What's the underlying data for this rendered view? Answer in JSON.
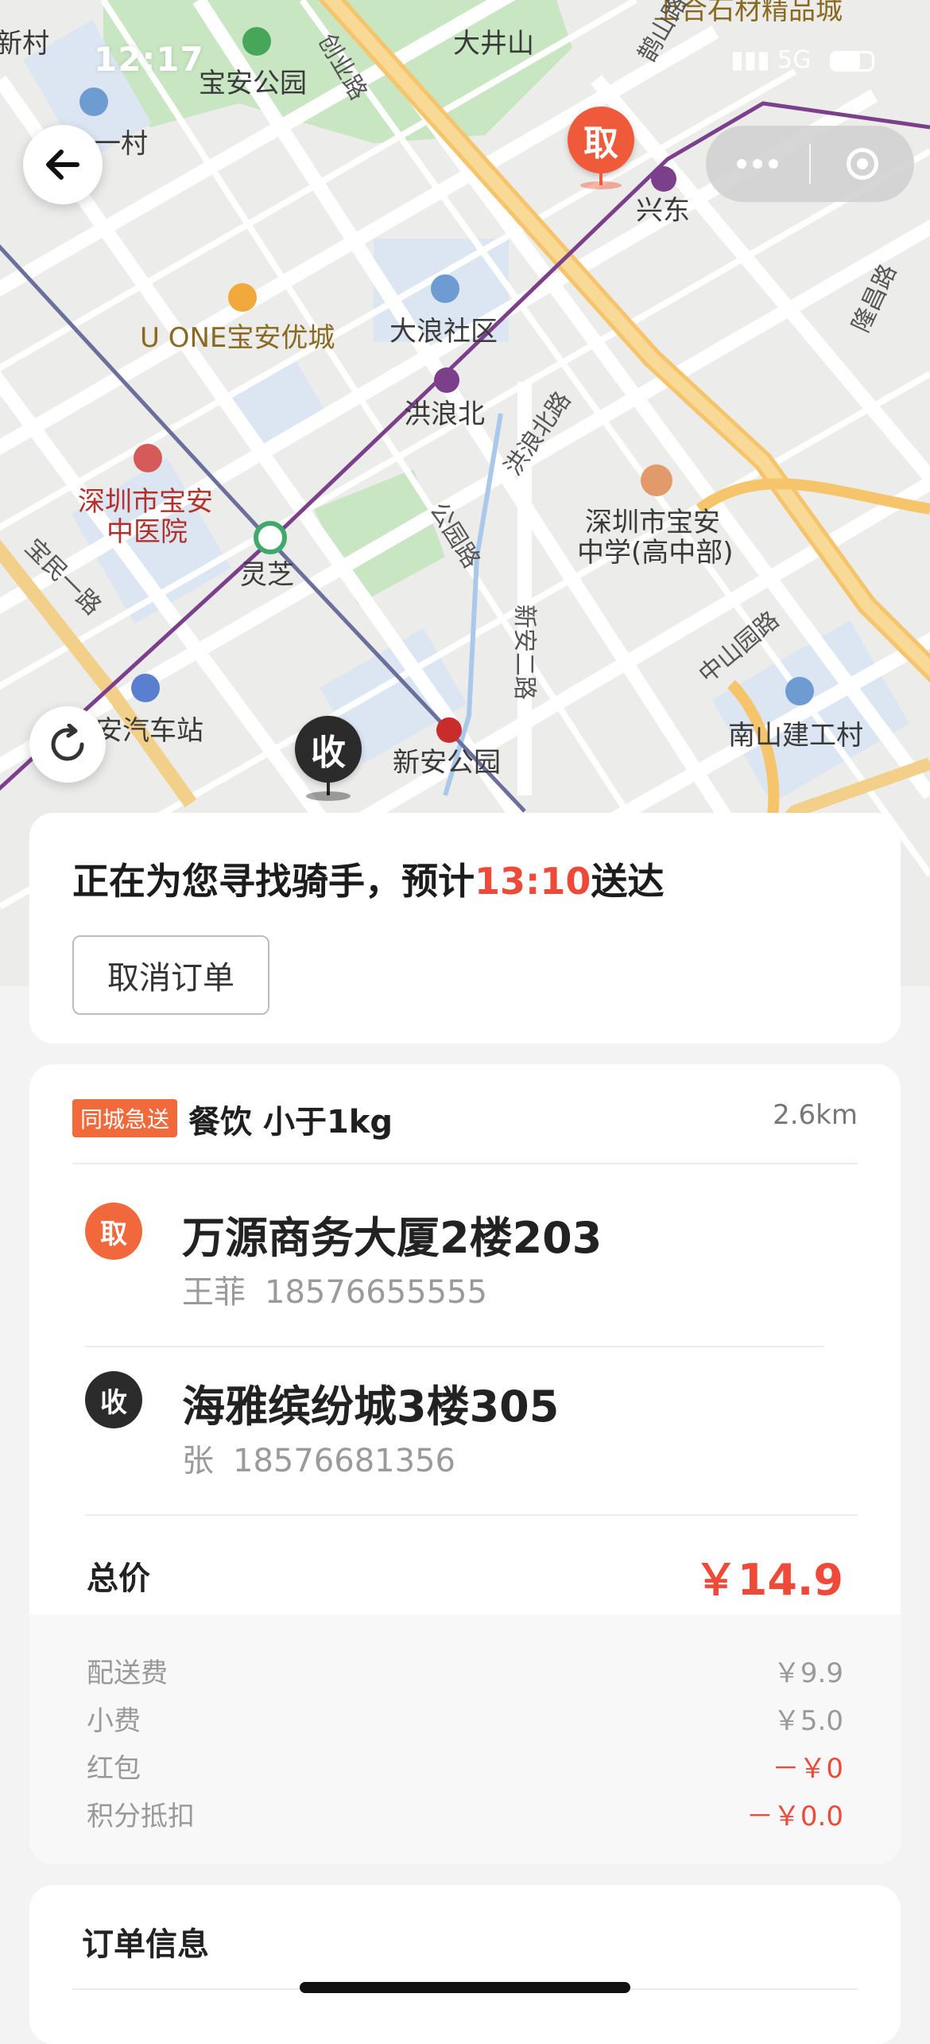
{
  "status_bar": {
    "time": "12:17",
    "network": "5G"
  },
  "map": {
    "labels": [
      {
        "text": "宝安公园",
        "kind": "poi-green"
      },
      {
        "text": "大井山",
        "kind": "plain"
      },
      {
        "text": "上合石材精品城",
        "kind": "poi"
      },
      {
        "text": "新村",
        "kind": "plain"
      },
      {
        "text": "一村",
        "kind": "plain"
      },
      {
        "text": "兴东",
        "kind": "metro"
      },
      {
        "text": "U ONE宝安优城",
        "kind": "poi"
      },
      {
        "text": "大浪社区",
        "kind": "plain"
      },
      {
        "text": "洪浪北",
        "kind": "metro"
      },
      {
        "text": "深圳市宝安",
        "kind": "hosp"
      },
      {
        "text": "中医院",
        "kind": "hosp"
      },
      {
        "text": "灵芝",
        "kind": "metro"
      },
      {
        "text": "深圳市宝安",
        "kind": "plain"
      },
      {
        "text": "中学(高中部)",
        "kind": "plain"
      },
      {
        "text": "安汽车站",
        "kind": "plain"
      },
      {
        "text": "新安公园",
        "kind": "metro"
      },
      {
        "text": "南山建工村",
        "kind": "plain"
      }
    ],
    "roads": [
      "洪浪北路",
      "公园路",
      "新安二路",
      "中山园路",
      "宝民一路",
      "鹊山路",
      "隆昌路",
      "创业路"
    ],
    "pickup_marker": "取",
    "dropoff_marker": "收"
  },
  "status_card": {
    "prefix": "正在为您寻找骑手，预计",
    "eta": "13:10",
    "suffix": "送达",
    "cancel_label": "取消订单"
  },
  "order": {
    "tag": "同城急送",
    "type": "餐饮 小于1kg",
    "distance": "2.6km",
    "pickup": {
      "badge": "取",
      "address": "万源商务大厦2楼203",
      "name": "王菲",
      "phone": "18576655555"
    },
    "dropoff": {
      "badge": "收",
      "address": "海雅缤纷城3楼305",
      "name": "张",
      "phone": "18576681356"
    },
    "total_label": "总价",
    "total_value": "￥14.9",
    "fees": [
      {
        "label": "配送费",
        "value": "￥9.9"
      },
      {
        "label": "小费",
        "value": "￥5.0"
      },
      {
        "label": "红包",
        "value": "－￥0"
      },
      {
        "label": "积分抵扣",
        "value": "－￥0.0"
      }
    ]
  },
  "info": {
    "title": "订单信息"
  },
  "colors": {
    "accent_red": "#ee4a3a",
    "pickup_orange": "#f0683c",
    "tag_orange": "#f06a3c",
    "metro_purple": "#7b3f8c"
  }
}
